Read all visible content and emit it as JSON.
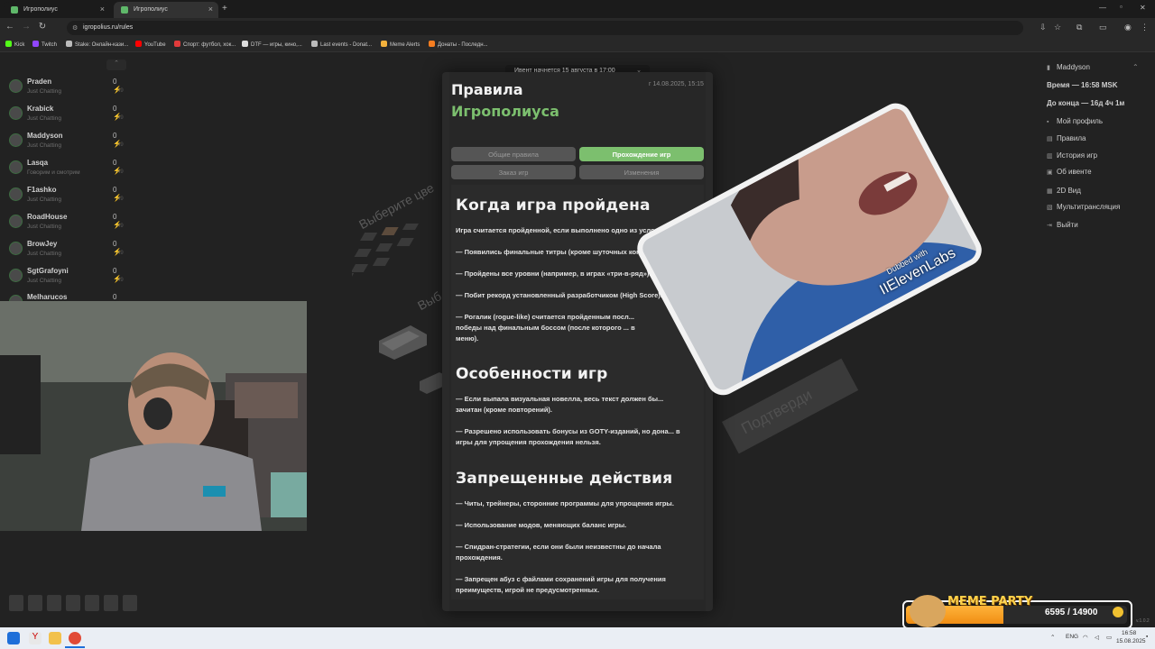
{
  "browser": {
    "tabs": [
      {
        "title": "Игрополиус",
        "active": false
      },
      {
        "title": "Игрополиус",
        "active": true
      }
    ],
    "new_tab": "+",
    "url": "igropolius.ru/rules",
    "window_controls": [
      "—",
      "▫",
      "✕"
    ],
    "bookmarks": [
      {
        "label": "Kick",
        "color": "#53fc18"
      },
      {
        "label": "Twitch",
        "color": "#9146ff"
      },
      {
        "label": "Stake: Онлайн-кази...",
        "color": "#bbbbbb"
      },
      {
        "label": "YouTube",
        "color": "#ff0000"
      },
      {
        "label": "Спорт: футбол, хок...",
        "color": "#e13b3b"
      },
      {
        "label": "DTF — игры, кино,...",
        "color": "#dddddd"
      },
      {
        "label": "Last events - Donat...",
        "color": "#bbbbbb"
      },
      {
        "label": "Meme Alerts",
        "color": "#f3b13c"
      },
      {
        "label": "Донаты - Последн...",
        "color": "#f57d20"
      }
    ]
  },
  "streamers": [
    {
      "name": "Praden",
      "status": "Just Chatting",
      "count": "0",
      "sub": "49"
    },
    {
      "name": "Krabick",
      "status": "Just Chatting",
      "count": "0",
      "sub": "49"
    },
    {
      "name": "Maddyson",
      "status": "Just Chatting",
      "count": "0",
      "sub": "49"
    },
    {
      "name": "Lasqa",
      "status": "Говорим и смотрим",
      "count": "0",
      "sub": "49"
    },
    {
      "name": "F1ashko",
      "status": "Just Chatting",
      "count": "0",
      "sub": "49"
    },
    {
      "name": "RoadHouse",
      "status": "Just Chatting",
      "count": "0",
      "sub": "49"
    },
    {
      "name": "BrowJey",
      "status": "Just Chatting",
      "count": "0",
      "sub": "49"
    },
    {
      "name": "SgtGrafoyni",
      "status": "Just Chatting",
      "count": "0",
      "sub": "49"
    },
    {
      "name": "Melharucos",
      "status": "",
      "count": "0",
      "sub": ""
    }
  ],
  "toast": {
    "text": "Ивент начнется 15 августа в 17:00",
    "close": "×"
  },
  "modal": {
    "title_line1": "Правила",
    "title_line2": "Игрополиуса",
    "updated": "г 14.08.2025, 15:15",
    "tabs": [
      "Общие правила",
      "Прохождение игр",
      "Заказ игр",
      "Изменения"
    ],
    "active_tab": 1,
    "sections": [
      {
        "heading": "Когда игра пройдена",
        "paragraphs": [
          "Игра считается пройденной, если выполнено одно из условий:",
          "— Появились финальные титры (кроме шуточных концовок).",
          "— Пройдены все уровни (например, в играх «три-в-ряд»).",
          "— Побит рекорд установленный разработчиком (High Score).",
          "— Рогалик (rogue-like) считается пройденным посл... победы над финальным боссом (после которого ... в меню)."
        ]
      },
      {
        "heading": "Особенности игр",
        "paragraphs": [
          "— Если выпала визуальная новелла, весь текст должен бы... зачитан (кроме повторений).",
          "— Разрешено использовать бонусы из GOTY-изданий, но дона... в игры для упрощения прохождения нельзя."
        ]
      },
      {
        "heading": "Запрещенные действия",
        "paragraphs": [
          "— Читы, трейнеры, сторонние программы для упрощения игры.",
          "— Использование модов, меняющих баланс игры.",
          "— Спидран-стратегии, если они были неизвестны до начала прохождения.",
          "— Запрещен абуз с файлами сохранений игры для получения преимуществ, игрой не предусмотренных."
        ]
      }
    ]
  },
  "background_text": {
    "select": "Выберите цве",
    "select2": "Выб",
    "confirm": "Подтверди"
  },
  "right_menu": {
    "user": "Maddyson",
    "time": "Время — 16:58 MSK",
    "remaining": "До конца — 16д 4ч 1м",
    "items": [
      {
        "label": "Мой профиль",
        "icon": "user-icon"
      },
      {
        "label": "Правила",
        "icon": "book-icon"
      },
      {
        "label": "История игр",
        "icon": "history-icon"
      },
      {
        "label": "Об ивенте",
        "icon": "info-icon"
      },
      {
        "label": "2D Вид",
        "icon": "grid-icon"
      },
      {
        "label": "Мультитрансляция",
        "icon": "multi-icon"
      },
      {
        "label": "Выйти",
        "icon": "exit-icon"
      }
    ]
  },
  "overlay_video": {
    "watermark_line1": "Dubbed with",
    "watermark_line2": "IIElevenLabs"
  },
  "meme_party": {
    "label": "MEME PARTY",
    "progress": "6595 / 14900",
    "fraction": 0.4426
  },
  "version": "v.1.0.2",
  "taskbar": {
    "lang": "ENG",
    "time": "16:58",
    "date": "15.08.2025"
  }
}
